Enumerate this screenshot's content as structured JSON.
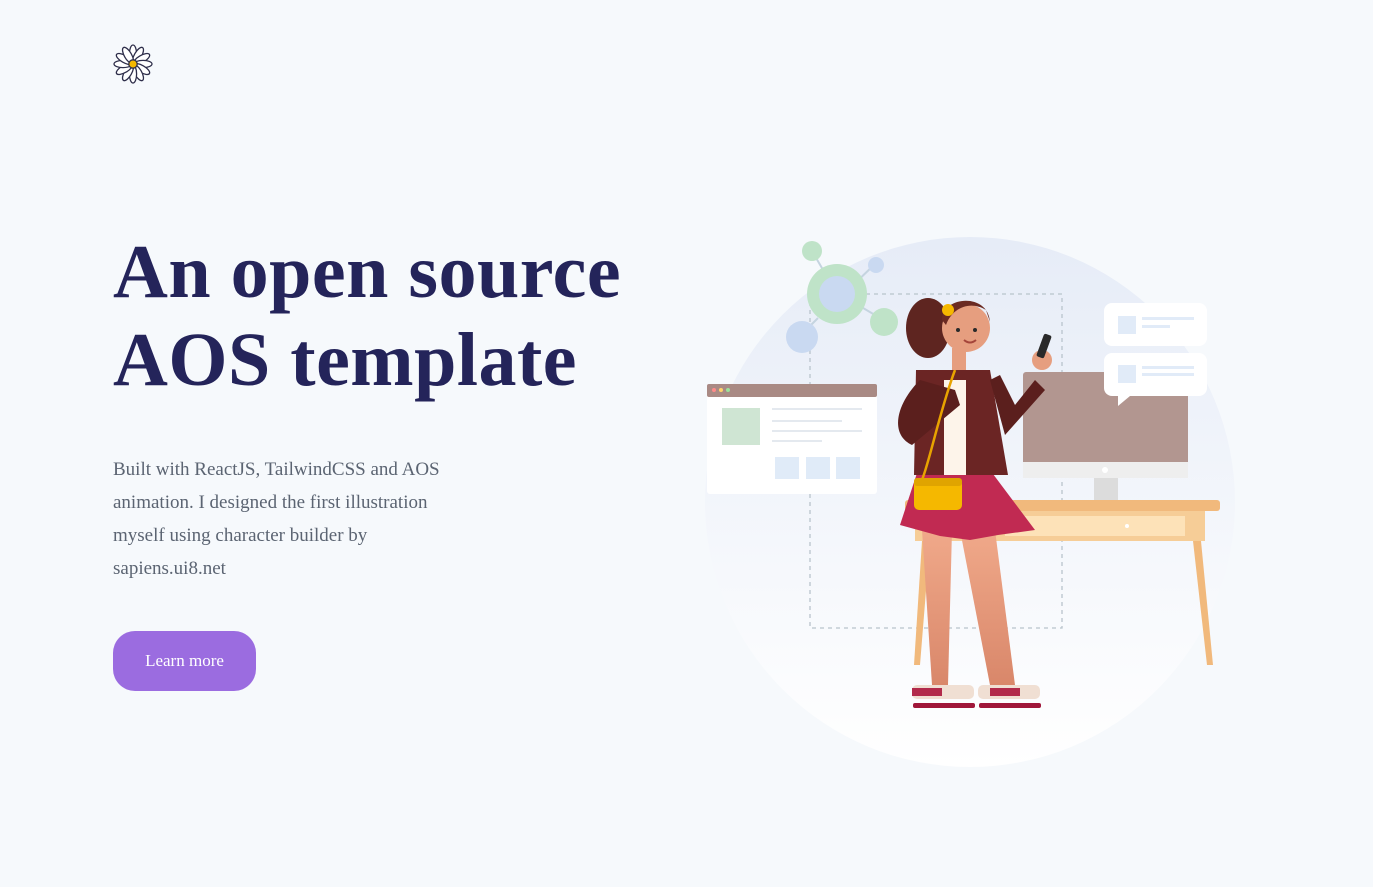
{
  "brand": {
    "logo_icon": "daisy-flower-icon"
  },
  "hero": {
    "title_line1": "An open source",
    "title_line2": "AOS template",
    "description": "Built with ReactJS, TailwindCSS and AOS animation. I designed the first illustration myself using character builder by sapiens.ui8.net",
    "cta_label": "Learn more"
  },
  "colors": {
    "background": "#f6f9fc",
    "title": "#24245a",
    "body_text": "#5b6472",
    "accent": "#9b6ce0"
  },
  "illustration": {
    "icon": "woman-at-desk-illustration"
  }
}
